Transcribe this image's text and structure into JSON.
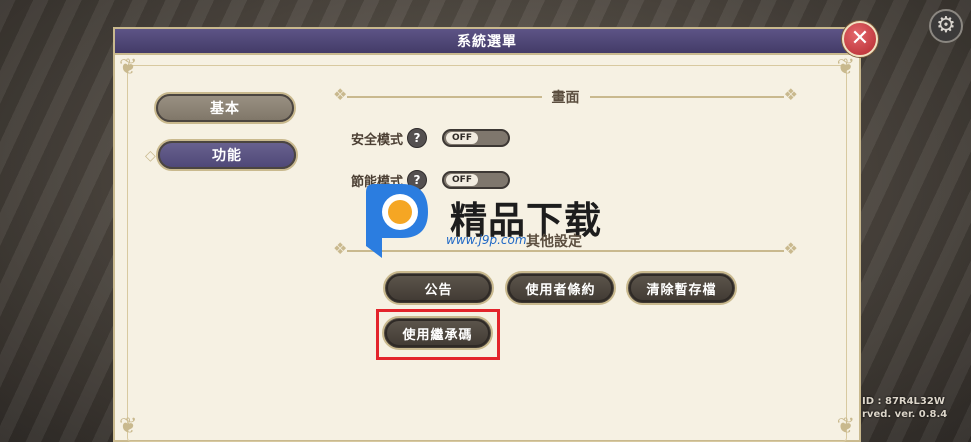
{
  "dialog": {
    "title": "系統選單",
    "close_symbol": "✕"
  },
  "top_right": {
    "icon": "gear-icon",
    "glyph": "⚙"
  },
  "tabs": [
    {
      "label": "基本"
    },
    {
      "label": "功能"
    }
  ],
  "display_section": {
    "title": "畫面",
    "settings": [
      {
        "label": "安全模式",
        "help": "?",
        "toggle": "OFF"
      },
      {
        "label": "節能模式",
        "help": "?",
        "toggle": "OFF"
      }
    ]
  },
  "other_section": {
    "title": "其他設定",
    "buttons": [
      {
        "label": "公告"
      },
      {
        "label": "使用者條約"
      },
      {
        "label": "清除暫存檔"
      },
      {
        "label": "使用繼承碼"
      }
    ]
  },
  "watermark": {
    "brand": "精品下载",
    "url": "www.j9p.com"
  },
  "footer": {
    "id_line": "ID : 87R4L32W",
    "version_line": "rved. ver. 0.8.4"
  },
  "colors": {
    "title_bar": "#4b4373",
    "panel_bg": "#f6f1e3",
    "gold_trim": "#c9b98e",
    "button_dark": "#4b453c",
    "highlight_red": "#e3242b",
    "close_red": "#c9353b"
  }
}
